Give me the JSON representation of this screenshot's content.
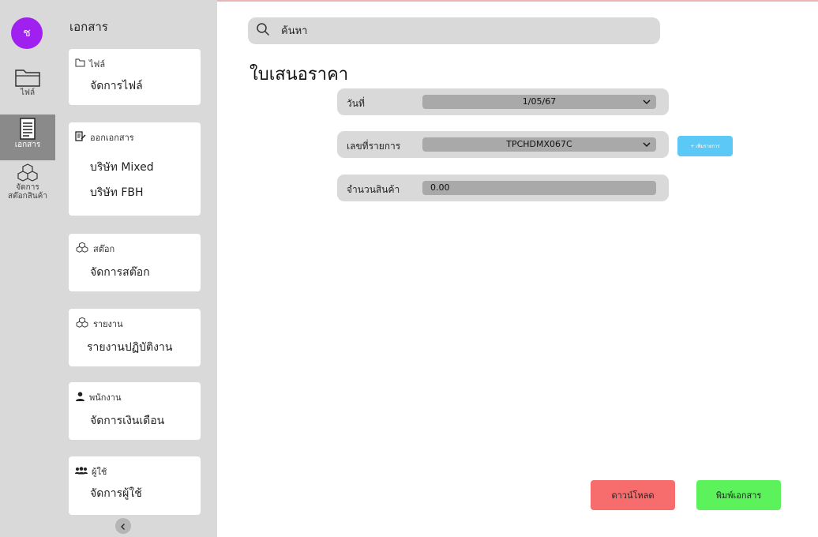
{
  "rail": {
    "avatar_letter": "ช",
    "items": [
      {
        "label": "ไฟล์",
        "icon": "folder-icon"
      },
      {
        "label": "เอกสาร",
        "icon": "document-icon"
      },
      {
        "label_line1": "จัดการ",
        "label_line2": "สต๊อกสินค้า",
        "icon": "boxes-icon"
      }
    ]
  },
  "panel": {
    "title": "เอกสาร",
    "cards": [
      {
        "head": "ไฟล์",
        "icon": "folder-icon",
        "lines": [
          "จัดการไฟล์"
        ]
      },
      {
        "head": "ออกเอกสาร",
        "icon": "edit-document-icon",
        "lines": [
          "บริษัท Mixed",
          "บริษัท FBH"
        ]
      },
      {
        "head": "สต๊อก",
        "icon": "boxes-icon",
        "lines": [
          "จัดการสต๊อก"
        ]
      },
      {
        "head": "รายงาน",
        "icon": "boxes-icon",
        "lines": [
          "รายงานปฏิบัติงาน"
        ]
      },
      {
        "head": "พนักงาน",
        "icon": "person-icon",
        "lines": [
          "จัดการเงินเดือน"
        ]
      },
      {
        "head": "ผู้ใช้",
        "icon": "users-icon",
        "lines": [
          "จัดการผู้ใช้"
        ]
      }
    ]
  },
  "search": {
    "placeholder": "ค้นหา"
  },
  "page_title": "ใบเสนอราคา",
  "form": {
    "date": {
      "label": "วันที่",
      "value": "1/05/67"
    },
    "item_no": {
      "label": "เลขที่รายการ",
      "value": "TPCHDMX067C"
    },
    "qty": {
      "label": "จำนวนสินค้า",
      "value": "0.00"
    },
    "add_label": "+ เพิ่มรายการ"
  },
  "actions": {
    "download": "ดาวน์โหลด",
    "print": "พิมพ์เอกสาร"
  },
  "colors": {
    "avatar": "#a020f0",
    "add": "#5bc8f5",
    "download": "#f76d6d",
    "print": "#5bf25b"
  }
}
